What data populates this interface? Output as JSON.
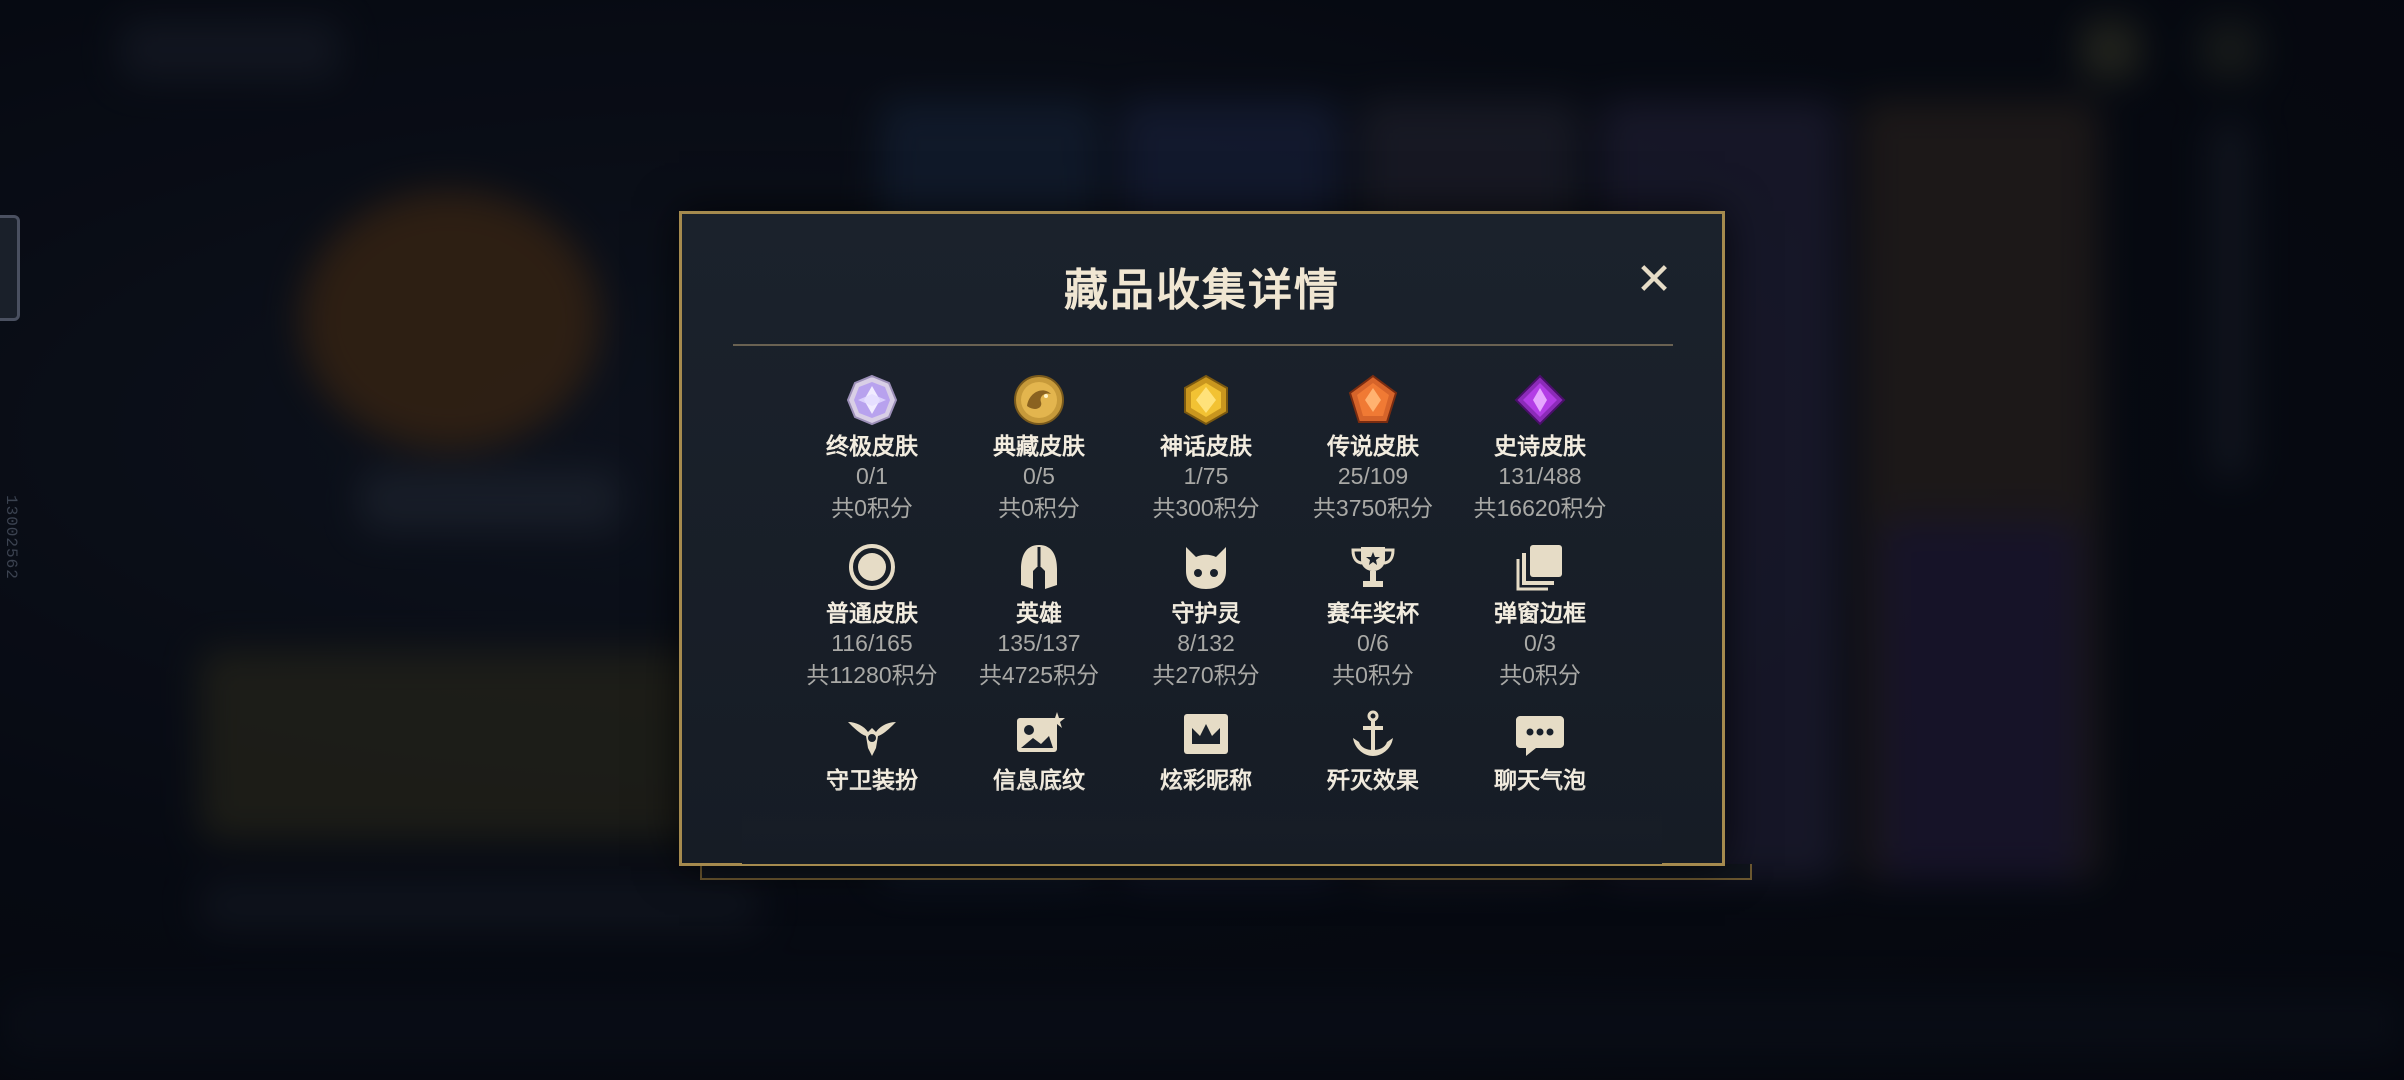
{
  "modal": {
    "title": "藏品收集详情",
    "close_label": "✕"
  },
  "side": {
    "id_text": "13002562"
  },
  "categories": [
    {
      "name": "终极皮肤",
      "count": "0/1",
      "points": "共0积分",
      "icon": "ultimate-gem-icon"
    },
    {
      "name": "典藏皮肤",
      "count": "0/5",
      "points": "共0积分",
      "icon": "prestige-dragon-icon"
    },
    {
      "name": "神话皮肤",
      "count": "1/75",
      "points": "共300积分",
      "icon": "mythic-gem-icon"
    },
    {
      "name": "传说皮肤",
      "count": "25/109",
      "points": "共3750积分",
      "icon": "legendary-gem-icon"
    },
    {
      "name": "史诗皮肤",
      "count": "131/488",
      "points": "共16620积分",
      "icon": "epic-gem-icon"
    },
    {
      "name": "普通皮肤",
      "count": "116/165",
      "points": "共11280积分",
      "icon": "standard-ring-icon"
    },
    {
      "name": "英雄",
      "count": "135/137",
      "points": "共4725积分",
      "icon": "helmet-icon"
    },
    {
      "name": "守护灵",
      "count": "8/132",
      "points": "共270积分",
      "icon": "little-legend-icon"
    },
    {
      "name": "赛年奖杯",
      "count": "0/6",
      "points": "共0积分",
      "icon": "trophy-icon"
    },
    {
      "name": "弹窗边框",
      "count": "0/3",
      "points": "共0积分",
      "icon": "frame-stack-icon"
    },
    {
      "name": "守卫装扮",
      "icon": "ward-skin-icon"
    },
    {
      "name": "信息底纹",
      "icon": "banner-image-icon"
    },
    {
      "name": "炫彩昵称",
      "icon": "crown-nameplate-icon"
    },
    {
      "name": "歼灭效果",
      "icon": "anchor-finisher-icon"
    },
    {
      "name": "聊天气泡",
      "icon": "chat-bubble-icon"
    }
  ]
}
